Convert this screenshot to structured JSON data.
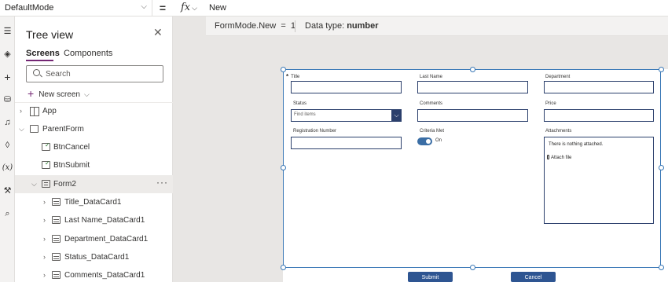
{
  "formula_bar": {
    "property": "DefaultMode",
    "equals": "=",
    "fx": "fx",
    "formula": "New"
  },
  "result": {
    "expression": "FormMode.New  =  1",
    "type_label": "Data type:",
    "type_value": "number"
  },
  "rail_icons": [
    "hamburger-icon",
    "layers-icon",
    "plus-icon",
    "database-icon",
    "media-icon",
    "theme-icon",
    "variables-icon",
    "tools-icon",
    "search-icon"
  ],
  "tree": {
    "title": "Tree view",
    "tabs": [
      "Screens",
      "Components"
    ],
    "search_placeholder": "Search",
    "new_screen": "New screen",
    "items": [
      {
        "label": "App"
      },
      {
        "label": "ParentForm"
      },
      {
        "label": "BtnCancel"
      },
      {
        "label": "BtnSubmit"
      },
      {
        "label": "Form2"
      },
      {
        "label": "Title_DataCard1"
      },
      {
        "label": "Last Name_DataCard1"
      },
      {
        "label": "Department_DataCard1"
      },
      {
        "label": "Status_DataCard1"
      },
      {
        "label": "Comments_DataCard1"
      }
    ]
  },
  "form": {
    "title_label": "Title",
    "required_mark": "*",
    "last_name_label": "Last Name",
    "department_label": "Department",
    "status_label": "Status",
    "status_placeholder": "Find items",
    "comments_label": "Comments",
    "price_label": "Price",
    "registration_label": "Registration Number",
    "criteria_label": "Criteria Met",
    "toggle_text": "On",
    "attachments_label": "Attachments",
    "attachments_empty": "There is nothing attached.",
    "attach_file": "Attach file",
    "submit": "Submit",
    "cancel": "Cancel"
  }
}
